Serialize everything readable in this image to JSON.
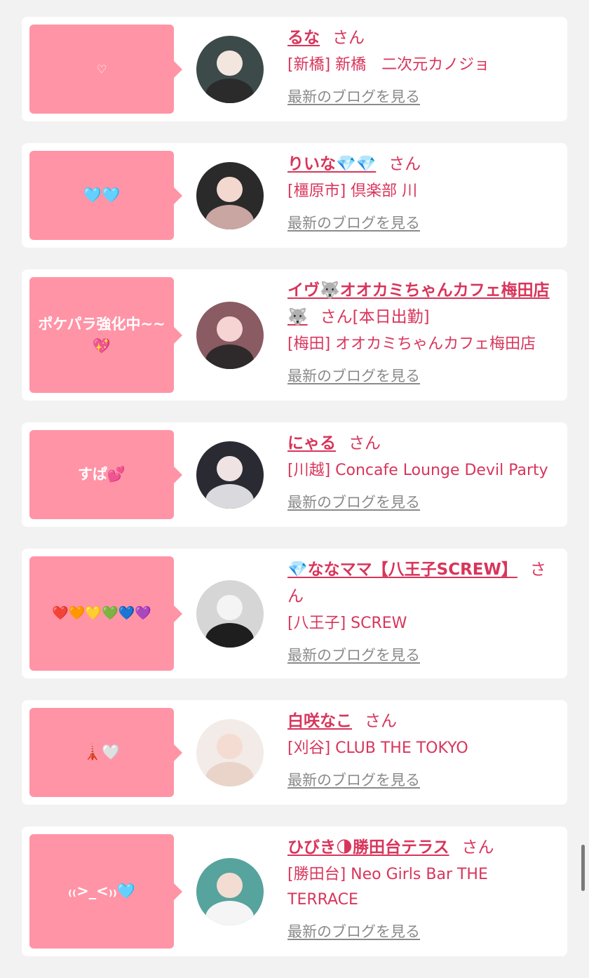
{
  "cards": [
    {
      "bubble": "♡",
      "name": "るな",
      "san": "さん",
      "extra": "",
      "shop": "[新橋] 新橋　二次元カノジョ",
      "blog_link": "最新のブログを見る",
      "avatar": {
        "bg": "#3c4a4a",
        "face": "#f3e6de",
        "body": "#2b2b2b"
      }
    },
    {
      "bubble": "🩵🩵",
      "name": "りいな💎💎",
      "san": "さん",
      "extra": "",
      "shop": "[橿原市] 倶楽部 川",
      "blog_link": "最新のブログを見る",
      "avatar": {
        "bg": "#2a2a2a",
        "face": "#f2d8cf",
        "body": "#c9a6a2"
      }
    },
    {
      "bubble": "ポケパラ強化中~~💖",
      "name": "イヴ🐺オオカミちゃんカフェ梅田店🐺",
      "san": "さん",
      "extra": "[本日出勤]",
      "shop": "[梅田] オオカミちゃんカフェ梅田店",
      "blog_link": "最新のブログを見る",
      "avatar": {
        "bg": "#8a5b63",
        "face": "#f6d4d4",
        "body": "#2e2a2c"
      }
    },
    {
      "bubble": "すぱ💕",
      "name": "にゃる",
      "san": "さん",
      "extra": "",
      "shop": "[川越] Concafe Lounge Devil Party",
      "blog_link": "最新のブログを見る",
      "avatar": {
        "bg": "#2a2a33",
        "face": "#efe3e3",
        "body": "#d9d9de"
      }
    },
    {
      "bubble": "❤️🧡💛💚💙💜",
      "name": "💎ななママ【八王子SCREW】",
      "san": "さん",
      "extra": "",
      "shop": "[八王子] SCREW",
      "blog_link": "最新のブログを見る",
      "avatar": {
        "bg": "#d6d6d6",
        "face": "#f4f4f4",
        "body": "#1e1e1e"
      }
    },
    {
      "bubble": "🗼🤍",
      "name": "白咲なこ",
      "san": "さん",
      "extra": "",
      "shop": "[刈谷] CLUB THE TOKYO",
      "blog_link": "最新のブログを見る",
      "avatar": {
        "bg": "#f3ebe7",
        "face": "#f4dcd2",
        "body": "#ead4c9"
      }
    },
    {
      "bubble": "₍₍>_<₎₎🩵",
      "name": "ひびき🌗勝田台テラス",
      "san": "さん",
      "extra": "",
      "shop": "[勝田台] Neo Girls Bar THE TERRACE",
      "blog_link": "最新のブログを見る",
      "avatar": {
        "bg": "#57a39e",
        "face": "#f3ddd2",
        "body": "#f5f5f5"
      }
    }
  ]
}
